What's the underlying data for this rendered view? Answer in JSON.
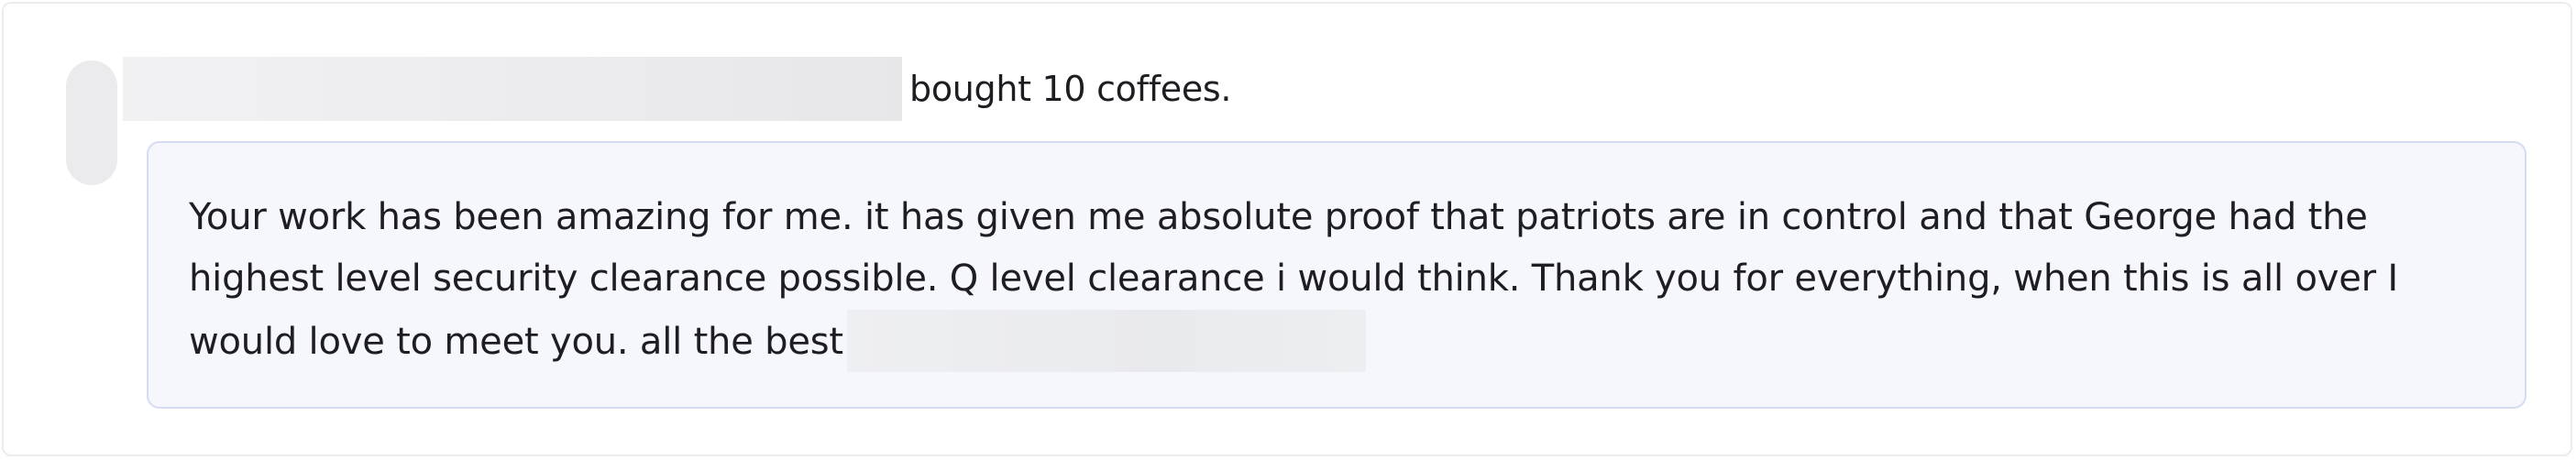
{
  "supporter": {
    "action_text": "bought 10 coffees."
  },
  "message": {
    "lines": [
      "Your work has been amazing for me. it has given me absolute proof that patriots are in control and that George had the",
      "highest level security clearance possible. Q level clearance i would think. Thank you for everything, when this is all over I",
      "would love to meet you. all the best"
    ]
  }
}
